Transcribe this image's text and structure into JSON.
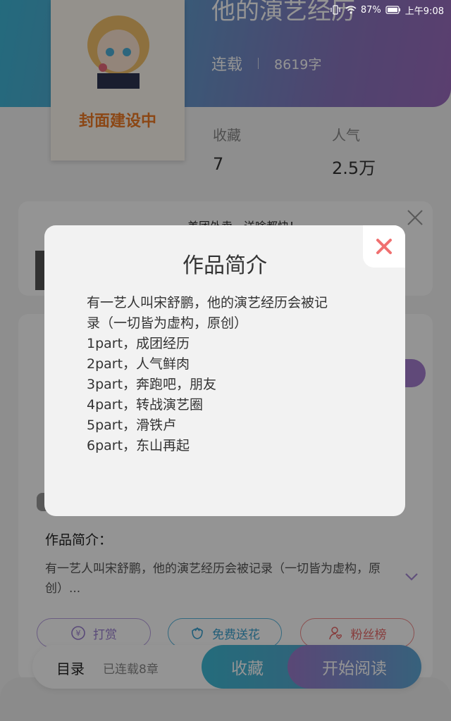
{
  "status": {
    "battery": "87%",
    "time": "上午9:08"
  },
  "book": {
    "title": "他的演艺经历",
    "cover_text": "封面建设中",
    "state": "连载",
    "word_count": "8619字",
    "stats": [
      {
        "label": "收藏",
        "value": "7"
      },
      {
        "label": "人气",
        "value": "2.5万"
      }
    ]
  },
  "ad": {
    "text": "美团外卖，送啥都快！"
  },
  "intro": {
    "label": "作品简介：",
    "text": "有一艺人叫宋舒鹏，他的演艺经历会被记录（一切皆为虚构，原创）..."
  },
  "actions": {
    "reward": "打赏",
    "flower": "免费送花",
    "fans": "粉丝榜"
  },
  "bottom": {
    "toc": "目录",
    "chapters": "已连载8章",
    "favorite": "收藏",
    "read": "开始阅读"
  },
  "modal": {
    "title": "作品简介",
    "lines": [
      "有一艺人叫宋舒鹏，他的演艺经历会被记",
      "录（一切皆为虚构，原创）",
      "1part，成团经历",
      "2part，人气鲜肉",
      "3part，奔跑吧，朋友",
      "4part，转战演艺圈",
      "5part，滑铁卢",
      "6part，东山再起"
    ]
  },
  "colors": {
    "accent_blue": "#3fb8d8",
    "accent_purple": "#9c6cc0",
    "close_red": "#f07070"
  }
}
